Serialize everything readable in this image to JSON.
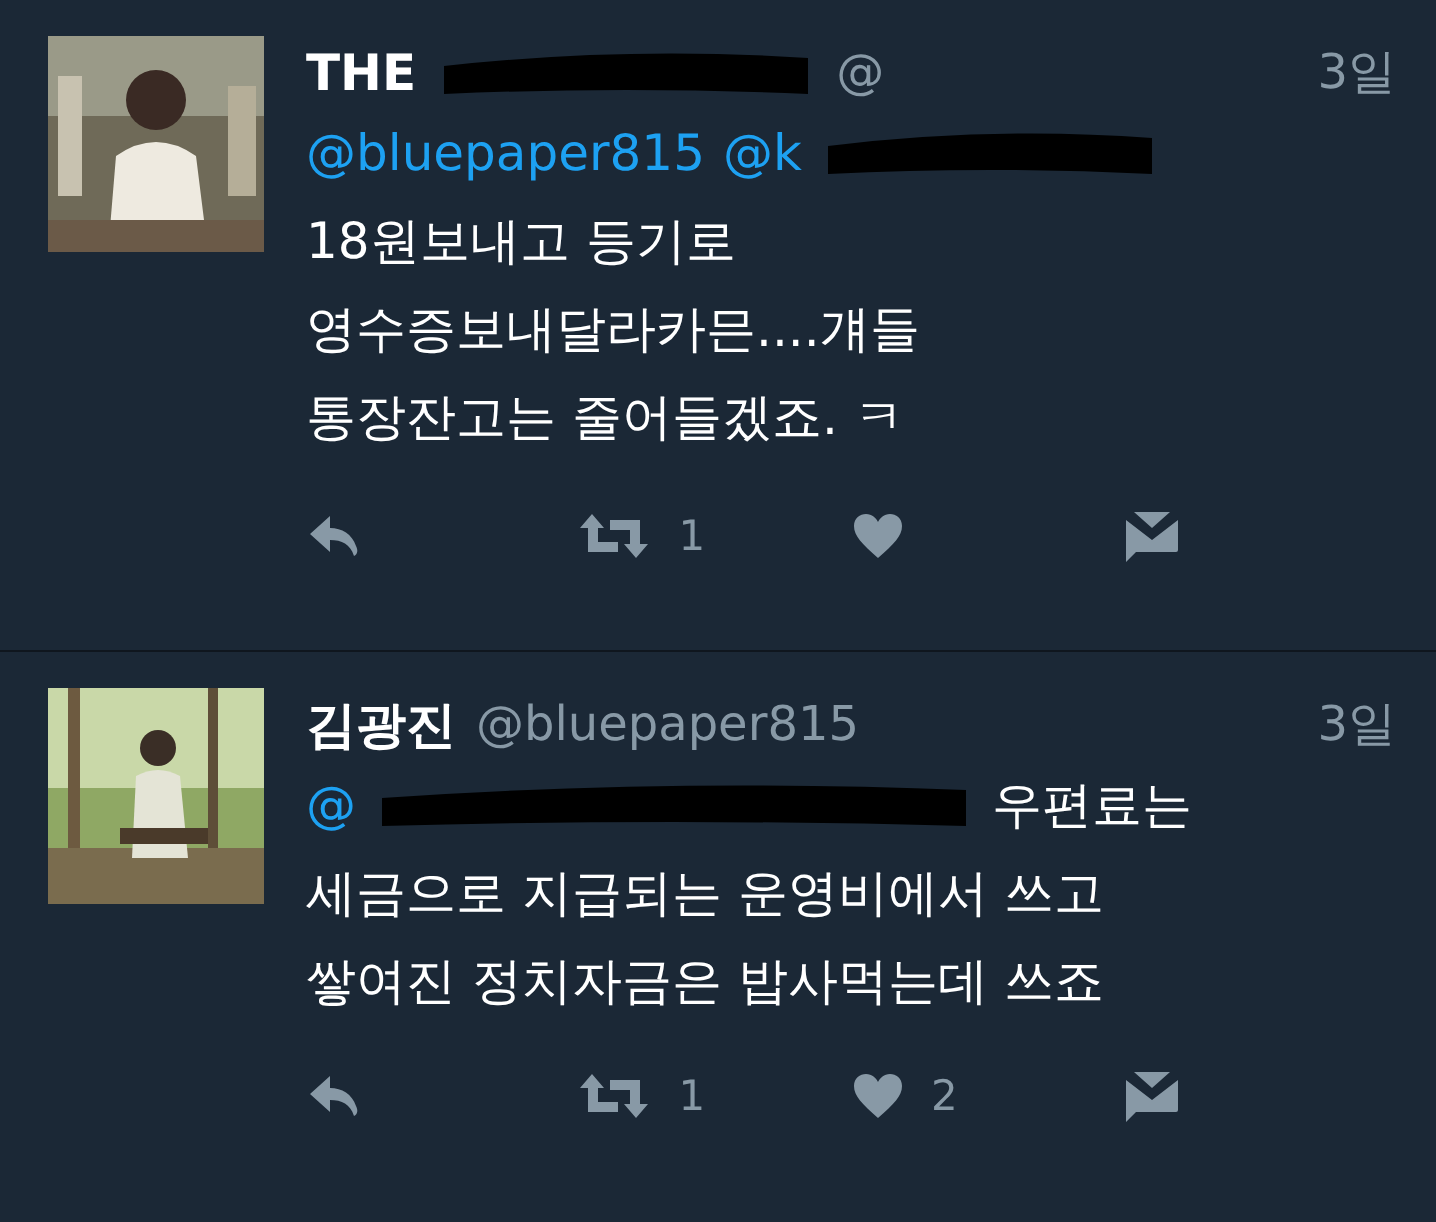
{
  "tweets": [
    {
      "header": [
        {
          "kind": "name",
          "text": "THE"
        },
        {
          "kind": "redacted"
        },
        {
          "kind": "handle",
          "text": "@"
        }
      ],
      "time": "3일",
      "first_line": [
        {
          "kind": "mention",
          "text": "@bluepaper815"
        },
        {
          "kind": "mention",
          "text": "@k"
        },
        {
          "kind": "redacted"
        }
      ],
      "lines": [
        "18원보내고 등기로",
        "영수증보내달라카믄....걔들",
        "통장잔고는 줄어들겠죠. ㅋ"
      ],
      "retweets": "1",
      "avatar": {
        "kind": "picture"
      }
    },
    {
      "header": [
        {
          "kind": "name",
          "text": "김광진"
        },
        {
          "kind": "handle",
          "text": "@bluepaper815"
        }
      ],
      "time": "3일",
      "first_line": [
        {
          "kind": "mention",
          "text": "@"
        },
        {
          "kind": "redacted"
        },
        {
          "kind": "text",
          "text": "우편료는"
        }
      ],
      "lines": [
        "세금으로 지급되는 운영비에서 쓰고",
        "쌓여진 정치자금은 밥사먹는데 쓰죠"
      ],
      "retweets": "1",
      "likes": "2",
      "avatar": {
        "kind": "picture"
      }
    }
  ]
}
